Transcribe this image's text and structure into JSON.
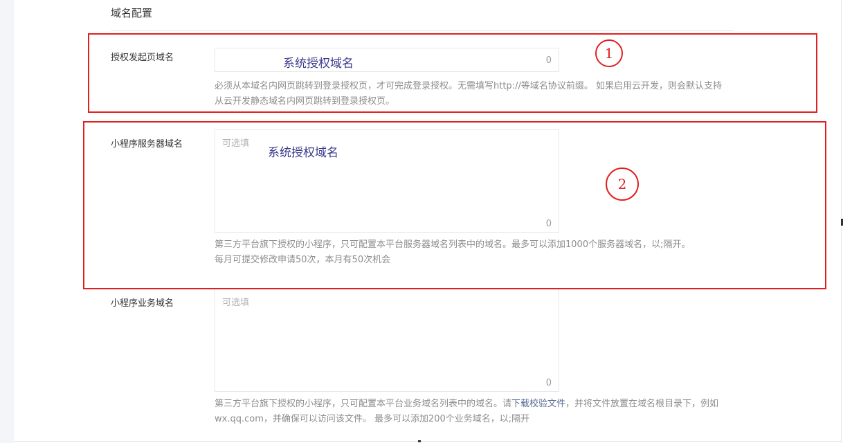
{
  "section": {
    "title": "域名配置"
  },
  "auth_domain": {
    "label": "授权发起页域名",
    "value": "系统授权域名",
    "counter": "0",
    "help": "必须从本域名内网页跳转到登录授权页，才可完成登录授权。无需填写http://等域名协议前缀。 如果启用云开发，则会默认支持从云开发静态域名内网页跳转到登录授权页。"
  },
  "server_domain": {
    "label": "小程序服务器域名",
    "placeholder": "可选填",
    "value": "系统授权域名",
    "counter": "0",
    "help_line1": "第三方平台旗下授权的小程序，只可配置本平台服务器域名列表中的域名。最多可以添加1000个服务器域名，以;隔开。",
    "help_line2": "每月可提交修改申请50次，本月有50次机会"
  },
  "business_domain": {
    "label": "小程序业务域名",
    "placeholder": "可选填",
    "counter": "0",
    "help_before_link": "第三方平台旗下授权的小程序，只可配置本平台业务域名列表中的域名。请",
    "help_link": "下载校验文件",
    "help_after_link": "，并将文件放置在域名根目录下，例如wx.qq.com，并确保可以访问该文件。 最多可以添加200个业务域名，以;隔开"
  },
  "annotations": {
    "marker_1": "1",
    "marker_2": "2",
    "color": "#e21f1f"
  }
}
